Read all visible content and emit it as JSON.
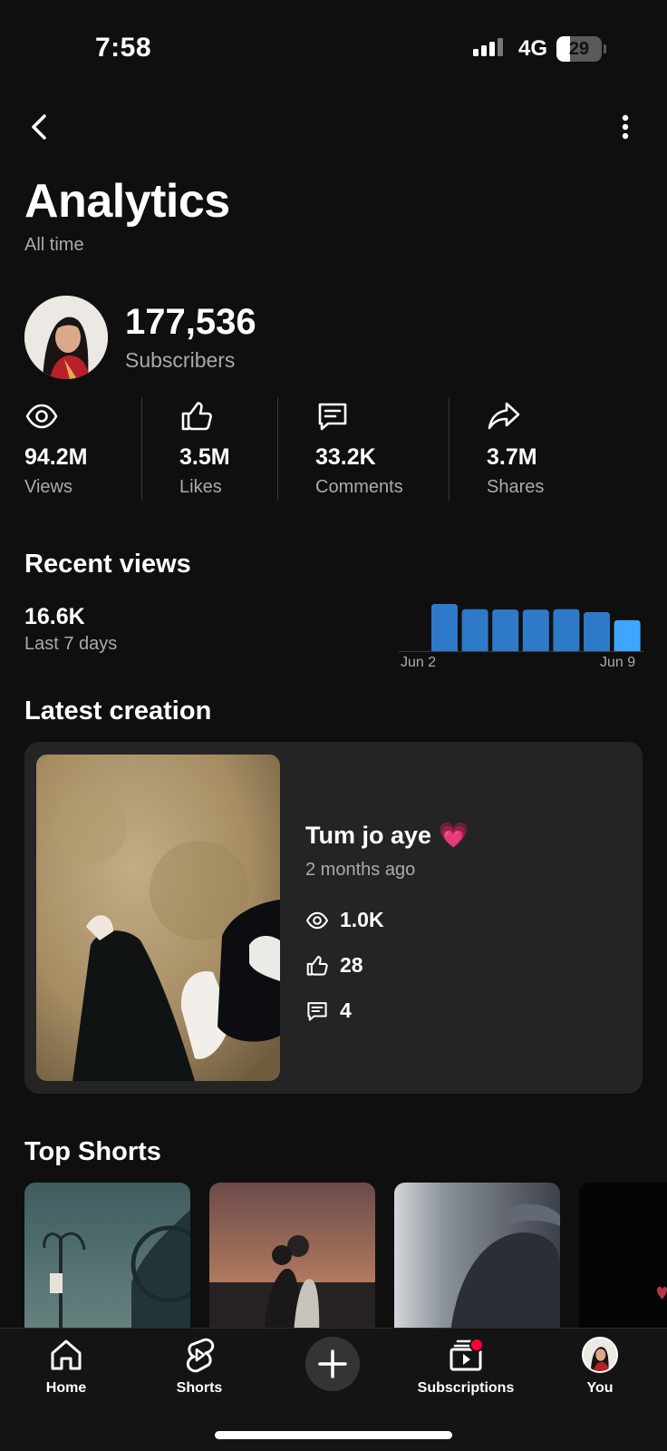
{
  "status_bar": {
    "time": "7:58",
    "network": "4G",
    "battery": "29",
    "battery_level": 0.29
  },
  "header": {
    "title": "Analytics",
    "subtitle": "All time",
    "back_icon": "chevron-left-icon",
    "more_icon": "more-vert-icon"
  },
  "channel": {
    "subscriber_count": "177,536",
    "subscriber_label": "Subscribers"
  },
  "stats": [
    {
      "value": "94.2M",
      "label": "Views",
      "icon": "eye-icon"
    },
    {
      "value": "3.5M",
      "label": "Likes",
      "icon": "thumb-up-icon"
    },
    {
      "value": "33.2K",
      "label": "Comments",
      "icon": "comment-icon"
    },
    {
      "value": "3.7M",
      "label": "Shares",
      "icon": "share-icon"
    }
  ],
  "recent_views": {
    "title": "Recent views",
    "value": "16.6K",
    "period": "Last 7 days",
    "start_label": "Jun 2",
    "end_label": "Jun 9"
  },
  "chart_data": {
    "type": "bar",
    "categories": [
      "Jun 2",
      "",
      "",
      "",
      "",
      "",
      "Jun 9"
    ],
    "values": [
      2.65,
      2.36,
      2.34,
      2.33,
      2.36,
      2.19,
      1.74
    ],
    "title": "",
    "xlabel": "",
    "ylabel": "",
    "grid": false,
    "colors": {
      "bar": "#2e7ac9",
      "last_bar": "#3ea6ff"
    }
  },
  "latest_creation": {
    "section_title": "Latest creation",
    "title": "Tum jo aye",
    "emoji": "💗",
    "time": "2 months ago",
    "views": "1.0K",
    "likes": "28",
    "comments": "4"
  },
  "top_shorts": {
    "title": "Top Shorts"
  },
  "nav": {
    "home": "Home",
    "shorts": "Shorts",
    "subscriptions": "Subscriptions",
    "you": "You"
  },
  "colors": {
    "background": "#0f0f0f",
    "card": "#242424",
    "accent_blue": "#3ea6ff",
    "notification_red": "#ff0033"
  }
}
